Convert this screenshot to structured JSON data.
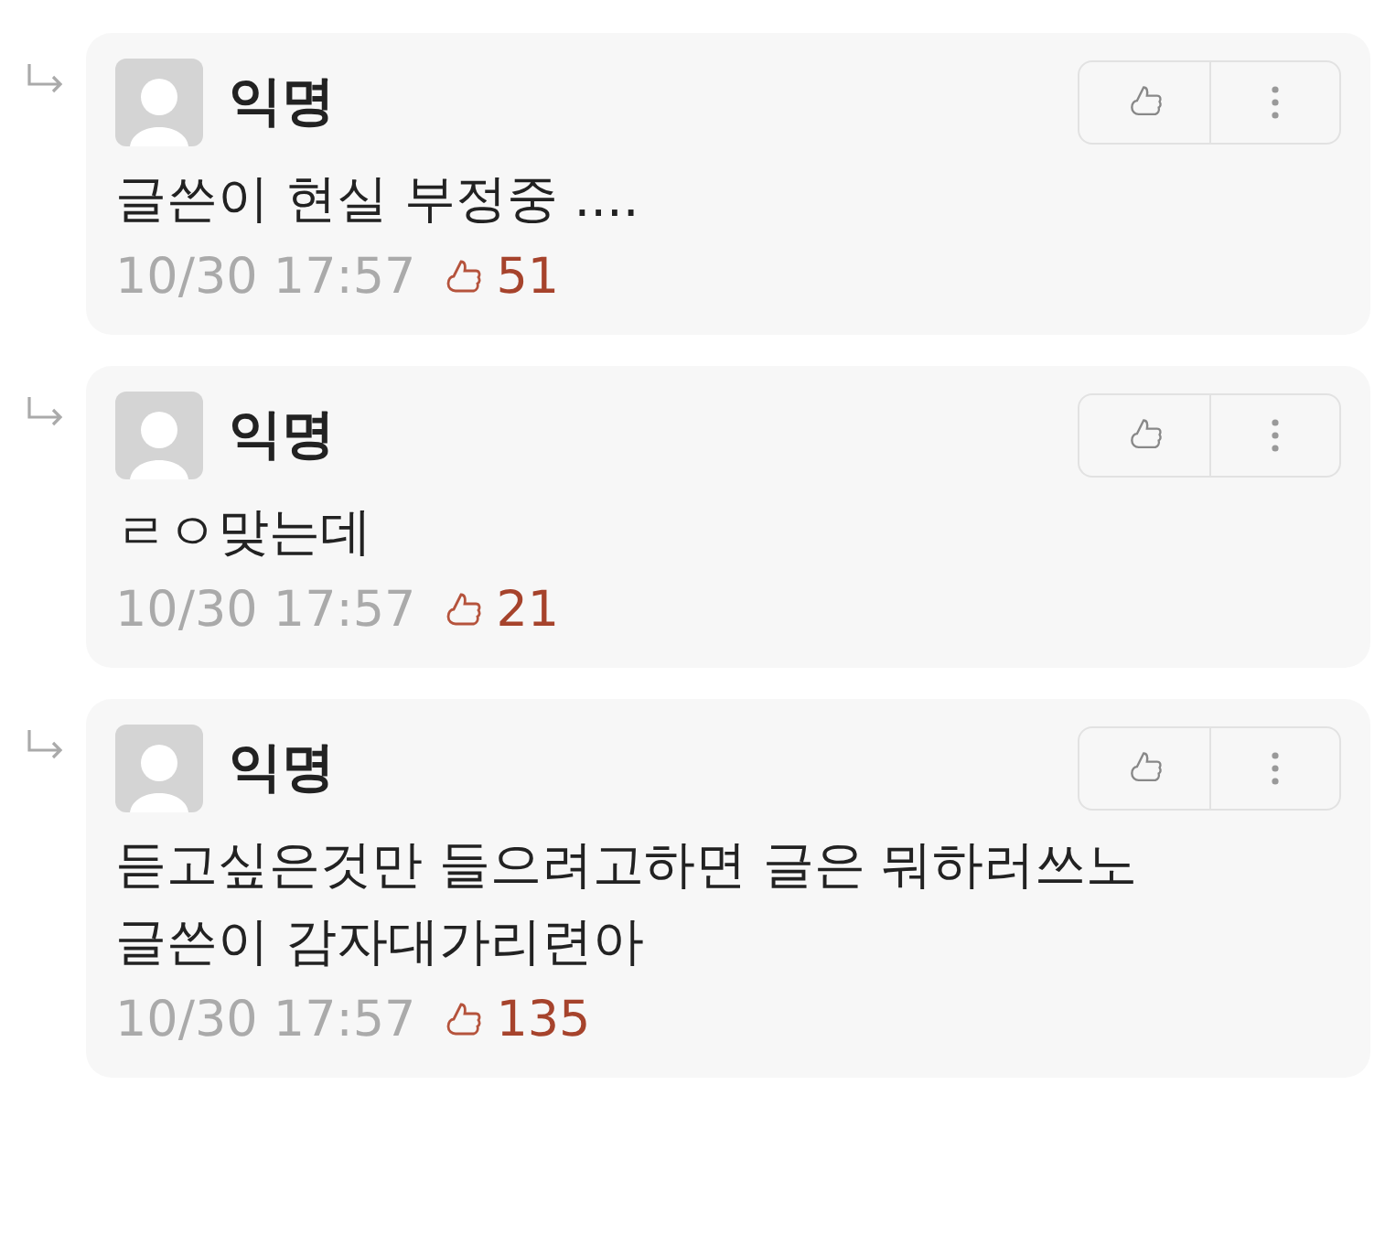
{
  "comments": [
    {
      "author": "익명",
      "text": "글쓴이 현실 부정중 ....",
      "time": "10/30 17:57",
      "likes": "51"
    },
    {
      "author": "익명",
      "text": "ㄹㅇ맞는데",
      "time": "10/30 17:57",
      "likes": "21"
    },
    {
      "author": "익명",
      "text": "듣고싶은것만 들으려고하면 글은 뭐하러쓰노\n글쓴이 감자대가리련아",
      "time": "10/30 17:57",
      "likes": "135"
    }
  ]
}
